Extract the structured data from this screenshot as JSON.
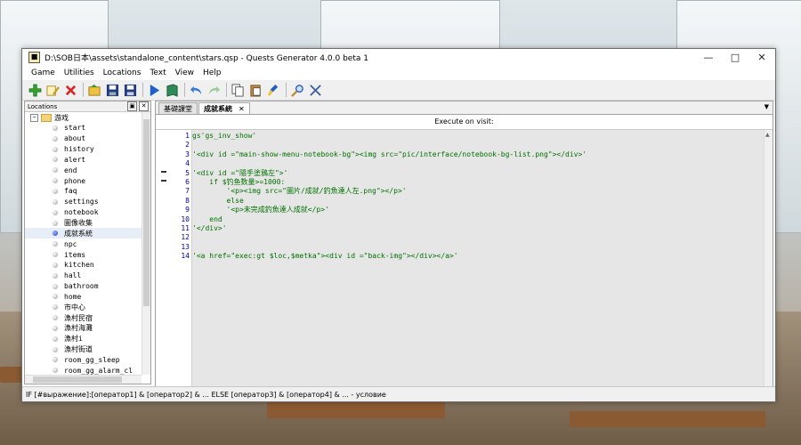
{
  "window": {
    "title": "D:\\SOB日本\\assets\\standalone_content\\stars.qsp - Quests Generator 4.0.0 beta 1",
    "minimize_icon": "minimize-icon",
    "maximize_icon": "maximize-icon",
    "close_icon": "close-icon"
  },
  "menu": [
    "Game",
    "Utilities",
    "Locations",
    "Text",
    "View",
    "Help"
  ],
  "toolbar": [
    {
      "name": "add-location-icon",
      "color": "#2ca02c"
    },
    {
      "name": "rename-location-icon",
      "color": "#e0b020"
    },
    {
      "name": "delete-location-icon",
      "color": "#d62728"
    },
    {
      "name": "open-game-icon",
      "color": "#f0c040"
    },
    {
      "name": "save-game-icon",
      "color": "#1f3a80"
    },
    {
      "name": "save-as-icon",
      "color": "#1f3a80"
    },
    {
      "name": "run-game-icon",
      "color": "#1f5fd0"
    },
    {
      "name": "help-book-icon",
      "color": "#2e8b57"
    },
    {
      "name": "undo-icon",
      "color": "#3a7bd5"
    },
    {
      "name": "redo-icon",
      "color": "#9ccf9c"
    },
    {
      "name": "copy-icon",
      "color": "#ffffff"
    },
    {
      "name": "paste-icon",
      "color": "#c88a40"
    },
    {
      "name": "clear-icon",
      "color": "#f0c040"
    },
    {
      "name": "find-icon",
      "color": "#3060c0"
    },
    {
      "name": "settings-tools-icon",
      "color": "#4060a0"
    }
  ],
  "locations_panel": {
    "title": "Locations",
    "root_label": "游戏",
    "items": [
      "start",
      "about",
      "history",
      "alert",
      "end",
      "phone",
      "faq",
      "settings",
      "notebook",
      "圖像收集",
      "成就系統",
      "npc",
      "items",
      "kitchen",
      "hall",
      "bathroom",
      "home",
      "市中心",
      "漁村民宿",
      "漁村海灘",
      "漁村i",
      "漁村街道",
      "room_gg_sleep",
      "room_gg_alarm_cl"
    ],
    "selected_index": 10
  },
  "tabs": [
    {
      "label": "基礎課堂",
      "active": false
    },
    {
      "label": "成就系統",
      "active": true
    }
  ],
  "editor": {
    "header": "Execute on visit:",
    "lines": [
      {
        "n": "1",
        "text": "gs'gs_inv_show'"
      },
      {
        "n": "2",
        "text": ""
      },
      {
        "n": "3",
        "text": "'<div id =\"main-show-menu-notebook-bg\"><img src=\"pic/interface/notebook-bg-list.png\"></div>'"
      },
      {
        "n": "4",
        "text": ""
      },
      {
        "n": "5",
        "text": "'<div id =\"隨手塗鴉左\">'"
      },
      {
        "n": "6",
        "text": "    if $钓鱼数量>=1000:"
      },
      {
        "n": "7",
        "text": "        '<p><img src=\"圖片/成就/釣魚達人左.png\"></p>'"
      },
      {
        "n": "8",
        "text": "        else"
      },
      {
        "n": "9",
        "text": "        '<p>未完成釣魚達人成就</p>'"
      },
      {
        "n": "10",
        "text": "    end"
      },
      {
        "n": "11",
        "text": "'</div>'"
      },
      {
        "n": "12",
        "text": ""
      },
      {
        "n": "13",
        "text": ""
      },
      {
        "n": "14",
        "text": "'<a href=\"exec:gt $loc,$metka\"><div id =\"back-img\"></div></a>'"
      }
    ]
  },
  "status": "IF [#выражение]:[оператор1] & [оператор2] & ... ELSE [оператор3] & [оператор4] & ... - условие"
}
